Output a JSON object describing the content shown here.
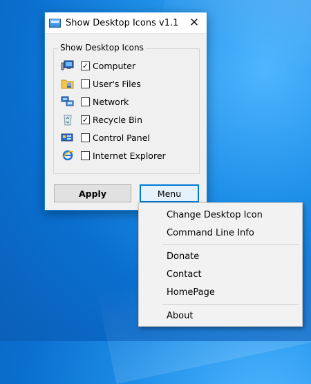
{
  "window": {
    "title": "Show Desktop Icons v1.1",
    "close_glyph": "✕",
    "group_title": "Show Desktop Icons",
    "items": [
      {
        "label": "Computer",
        "checked": true,
        "icon": "computer-icon"
      },
      {
        "label": "User's Files",
        "checked": false,
        "icon": "user-folder-icon"
      },
      {
        "label": "Network",
        "checked": false,
        "icon": "network-icon"
      },
      {
        "label": "Recycle Bin",
        "checked": true,
        "icon": "recycle-bin-icon"
      },
      {
        "label": "Control Panel",
        "checked": false,
        "icon": "control-panel-icon"
      },
      {
        "label": "Internet Explorer",
        "checked": false,
        "icon": "internet-explorer-icon"
      }
    ],
    "apply_label": "Apply",
    "menu_label": "Menu"
  },
  "menu": {
    "items": [
      "Change Desktop Icon",
      "Command Line Info",
      "Donate",
      "Contact",
      "HomePage",
      "About"
    ]
  },
  "colors": {
    "accent": "#0078d7",
    "desktop": "#1e8fe8"
  }
}
